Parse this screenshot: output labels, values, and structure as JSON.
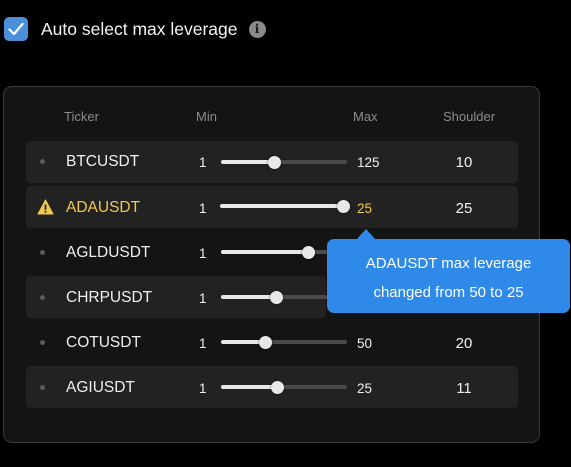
{
  "settings": {
    "auto_select_label": "Auto select max leverage",
    "auto_select_checked": true,
    "info_icon": "info-icon"
  },
  "table": {
    "headers": {
      "ticker": "Ticker",
      "min": "Min",
      "max": "Max",
      "shoulder": "Shoulder"
    },
    "rows": [
      {
        "ticker": "BTCUSDT",
        "min": "1",
        "max": "125",
        "shoulder": "10",
        "warning": false
      },
      {
        "ticker": "ADAUSDT",
        "min": "1",
        "max": "25",
        "shoulder": "25",
        "warning": true
      },
      {
        "ticker": "AGLDUSDT",
        "min": "1",
        "max": "",
        "shoulder": "",
        "warning": false
      },
      {
        "ticker": "CHRPUSDT",
        "min": "1",
        "max": "",
        "shoulder": "",
        "warning": false
      },
      {
        "ticker": "COTUSDT",
        "min": "1",
        "max": "50",
        "shoulder": "20",
        "warning": false
      },
      {
        "ticker": "AGIUSDT",
        "min": "1",
        "max": "25",
        "shoulder": "11",
        "warning": false
      }
    ]
  },
  "tooltip": {
    "line1": "ADAUSDT max leverage",
    "line2": "changed from 50 to 25"
  },
  "colors": {
    "accent": "#2f89e9",
    "warning": "#f2c94c",
    "checkbox": "#4a90d9"
  }
}
